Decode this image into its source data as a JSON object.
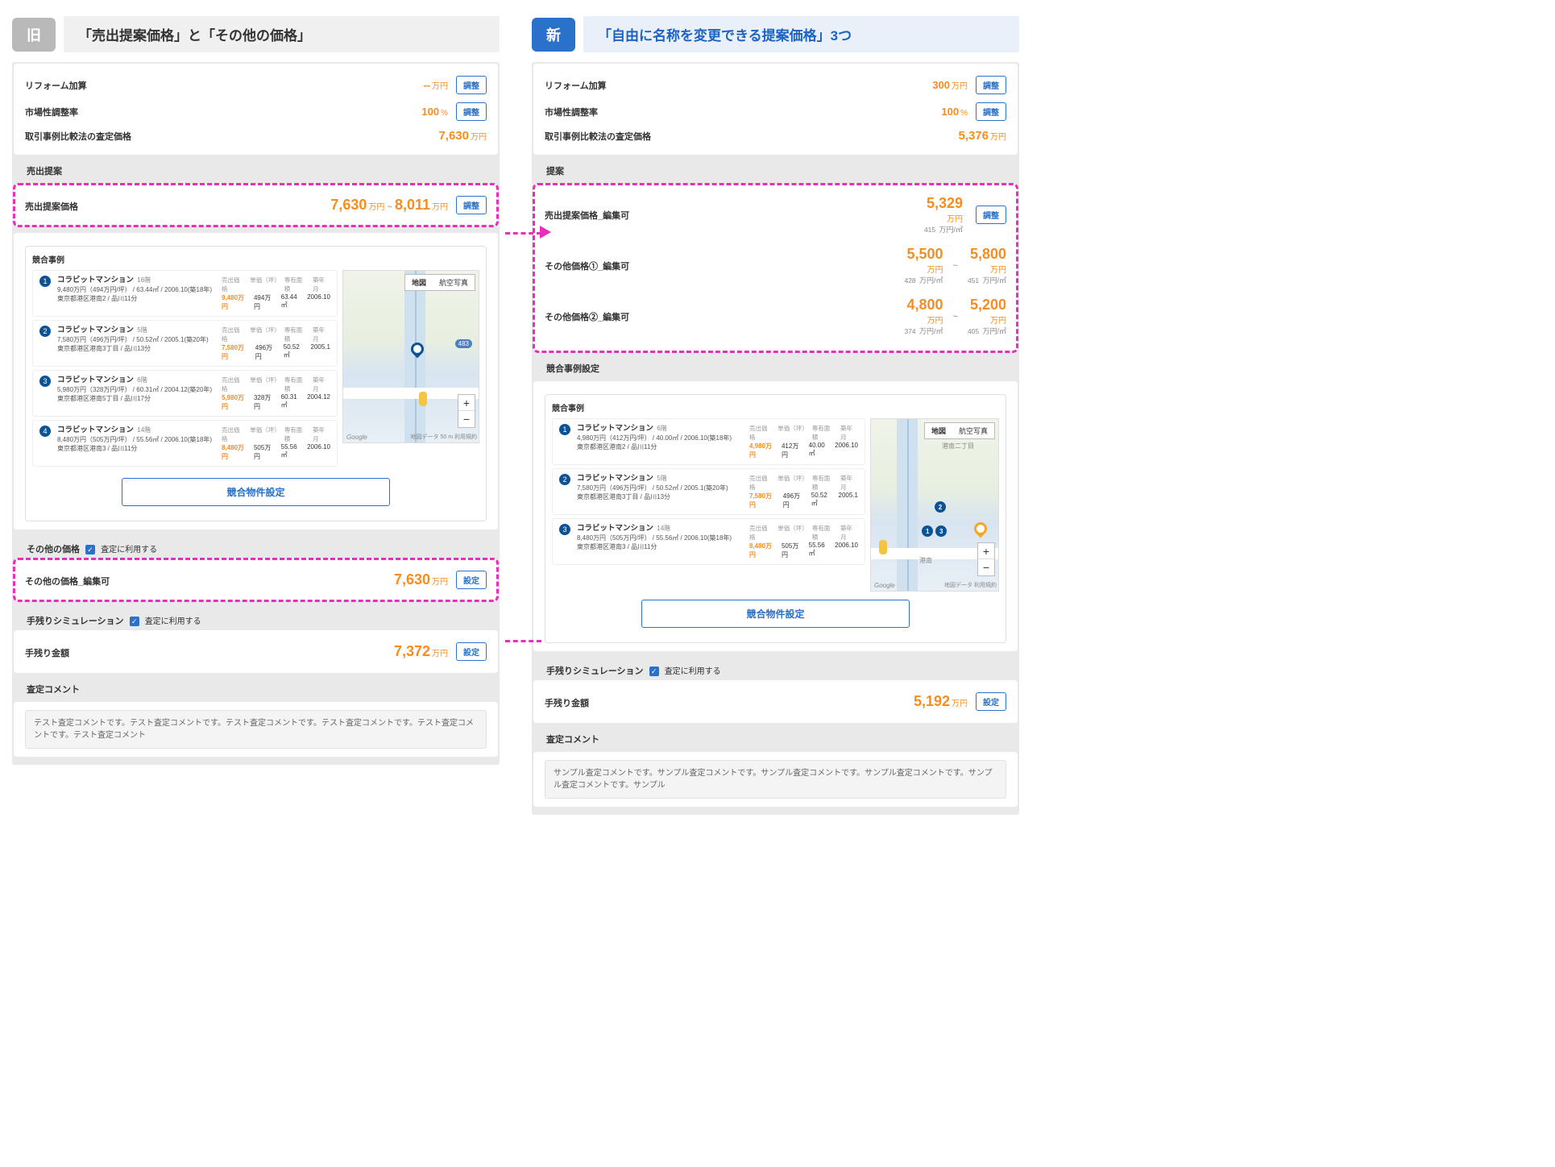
{
  "left": {
    "badge": "旧",
    "title": "「売出提案価格」と「その他の価格」",
    "top": {
      "reform_label": "リフォーム加算",
      "reform_value": "--",
      "reform_unit": "万円",
      "rate_label": "市場性調整率",
      "rate_value": "100",
      "rate_unit": "%",
      "comp_price_label": "取引事例比較法の査定価格",
      "comp_price_value": "7,630",
      "comp_price_unit": "万円",
      "adjust_btn": "調整"
    },
    "section_propose": "売出提案",
    "propose": {
      "label": "売出提案価格",
      "low": "7,630",
      "high": "8,011",
      "unit": "万円",
      "adjust_btn": "調整"
    },
    "comp_title": "競合事例",
    "comp_items": [
      {
        "no": "1",
        "name": "コラビットマンション",
        "floor": "16階",
        "line1": "9,480万円（494万円/坪） / 63.44㎡ / 2006.10(築18年)",
        "line2": "東京都港区港南2 / 品川11分",
        "h1": "売出価格",
        "h2": "単価（坪）",
        "h3": "専有面積",
        "h4": "築年月",
        "v1": "9,480万円",
        "v2": "494万円",
        "v3": "63.44㎡",
        "v4": "2006.10"
      },
      {
        "no": "2",
        "name": "コラビットマンション",
        "floor": "5階",
        "line1": "7,580万円（496万円/坪） / 50.52㎡ / 2005.1(築20年)",
        "line2": "東京都港区港南3丁目 / 品川13分",
        "h1": "売出価格",
        "h2": "単価（坪）",
        "h3": "専有面積",
        "h4": "築年月",
        "v1": "7,580万円",
        "v2": "496万円",
        "v3": "50.52㎡",
        "v4": "2005.1"
      },
      {
        "no": "3",
        "name": "コラビットマンション",
        "floor": "6階",
        "line1": "5,980万円（328万円/坪） / 60.31㎡ / 2004.12(築20年)",
        "line2": "東京都港区港南5丁目 / 品川17分",
        "h1": "売出価格",
        "h2": "単価（坪）",
        "h3": "専有面積",
        "h4": "築年月",
        "v1": "5,980万円",
        "v2": "328万円",
        "v3": "60.31㎡",
        "v4": "2004.12"
      },
      {
        "no": "4",
        "name": "コラビットマンション",
        "floor": "14階",
        "line1": "8,480万円（505万円/坪） / 55.56㎡ / 2006.10(築18年)",
        "line2": "東京都港区港南3 / 品川11分",
        "h1": "売出価格",
        "h2": "単価（坪）",
        "h3": "専有面積",
        "h4": "築年月",
        "v1": "8,480万円",
        "v2": "505万円",
        "v3": "55.56㎡",
        "v4": "2006.10"
      }
    ],
    "map": {
      "tab_map": "地図",
      "tab_sat": "航空写真",
      "route_badge": "483",
      "zoom_in": "+",
      "zoom_out": "−",
      "google": "Google",
      "credit": "地図データ   50 m      利用規約"
    },
    "comp_config_btn": "競合物件設定",
    "other_section": "その他の価格",
    "use_in_assessment": "査定に利用する",
    "other_label": "その他の価格_編集可",
    "other_value": "7,630",
    "other_unit": "万円",
    "settings_btn": "設定",
    "sim_section": "手残りシミュレーション",
    "sim_label": "手残り金額",
    "sim_value": "7,372",
    "sim_unit": "万円",
    "comment_section": "査定コメント",
    "comment_text": "テスト査定コメントです。テスト査定コメントです。テスト査定コメントです。テスト査定コメントです。テスト査定コメントです。テスト査定コメント"
  },
  "right": {
    "badge": "新",
    "title": "「自由に名称を変更できる提案価格」3つ",
    "top": {
      "reform_label": "リフォーム加算",
      "reform_value": "300",
      "reform_unit": "万円",
      "rate_label": "市場性調整率",
      "rate_value": "100",
      "rate_unit": "%",
      "comp_price_label": "取引事例比較法の査定価格",
      "comp_price_value": "5,376",
      "comp_price_unit": "万円",
      "adjust_btn": "調整"
    },
    "section_propose": "提案",
    "propose_rows": [
      {
        "label": "売出提案価格_編集可",
        "low": "",
        "low_sub": "",
        "high": "5,329",
        "high_sub": "415",
        "show_low": false,
        "btn": "調整"
      },
      {
        "label": "その他価格①_編集可",
        "low": "5,500",
        "low_sub": "428",
        "high": "5,800",
        "high_sub": "451",
        "show_low": true
      },
      {
        "label": "その他価格②_編集可",
        "low": "4,800",
        "low_sub": "374",
        "high": "5,200",
        "high_sub": "405",
        "show_low": true
      }
    ],
    "unit": "万円",
    "sub_unit": "万円/㎡",
    "comp_config_section": "競合事例設定",
    "comp_title": "競合事例",
    "comp_items": [
      {
        "no": "1",
        "name": "コラビットマンション",
        "floor": "6階",
        "line1": "4,980万円（412万円/坪） / 40.00㎡ / 2006.10(築18年)",
        "line2": "東京都港区港南2 / 品川11分",
        "h1": "売出価格",
        "h2": "単価（坪）",
        "h3": "専有面積",
        "h4": "築年月",
        "v1": "4,980万円",
        "v2": "412万円",
        "v3": "40.00㎡",
        "v4": "2006.10"
      },
      {
        "no": "2",
        "name": "コラビットマンション",
        "floor": "5階",
        "line1": "7,580万円（496万円/坪） / 50.52㎡ / 2005.1(築20年)",
        "line2": "東京都港区港南3丁目 / 品川13分",
        "h1": "売出価格",
        "h2": "単価（坪）",
        "h3": "専有面積",
        "h4": "築年月",
        "v1": "7,580万円",
        "v2": "496万円",
        "v3": "50.52㎡",
        "v4": "2005.1"
      },
      {
        "no": "3",
        "name": "コラビットマンション",
        "floor": "14階",
        "line1": "8,480万円（505万円/坪） / 55.56㎡ / 2006.10(築18年)",
        "line2": "東京都港区港南3 / 品川11分",
        "h1": "売出価格",
        "h2": "単価（坪）",
        "h3": "専有面積",
        "h4": "築年月",
        "v1": "8,480万円",
        "v2": "505万円",
        "v3": "55.56㎡",
        "v4": "2006.10"
      }
    ],
    "map": {
      "tab_map": "地図",
      "tab_sat": "航空写真",
      "label1": "港南二丁目",
      "label2": "港南",
      "zoom_in": "+",
      "zoom_out": "−",
      "google": "Google",
      "credit": "地図データ      利用規約"
    },
    "comp_config_btn": "競合物件設定",
    "sim_section": "手残りシミュレーション",
    "use_in_assessment": "査定に利用する",
    "sim_label": "手残り金額",
    "sim_value": "5,192",
    "sim_unit": "万円",
    "settings_btn": "設定",
    "comment_section": "査定コメント",
    "comment_text": "サンプル査定コメントです。サンプル査定コメントです。サンプル査定コメントです。サンプル査定コメントです。サンプル査定コメントです。サンプル"
  }
}
